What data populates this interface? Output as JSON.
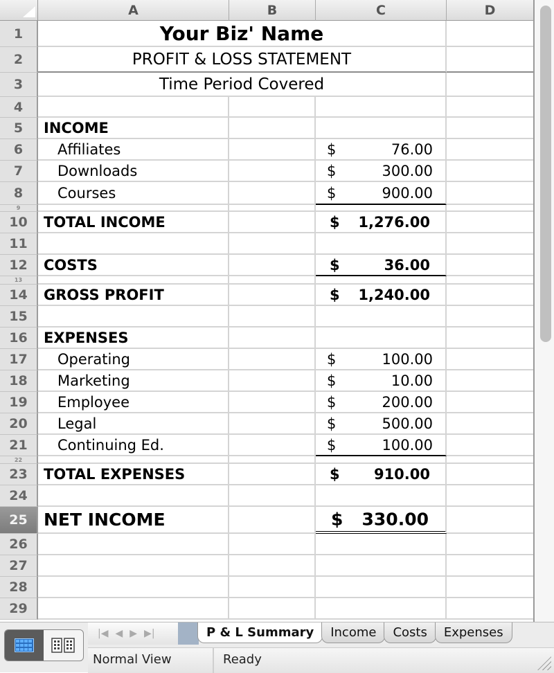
{
  "columns": [
    "A",
    "B",
    "C",
    "D"
  ],
  "header": {
    "biz_name": "Your Biz' Name",
    "statement": "PROFIT & LOSS STATEMENT",
    "period": "Time Period Covered"
  },
  "rows": {
    "r1": "1",
    "r2": "2",
    "r3": "3",
    "r4": "4",
    "r5": "5",
    "r6": "6",
    "r7": "7",
    "r8": "8",
    "r9": "9",
    "r10": "10",
    "r11": "11",
    "r12": "12",
    "r13": "13",
    "r14": "14",
    "r15": "15",
    "r16": "16",
    "r17": "17",
    "r18": "18",
    "r19": "19",
    "r20": "20",
    "r21": "21",
    "r22": "22",
    "r23": "23",
    "r24": "24",
    "r25": "25",
    "r26": "26",
    "r27": "27",
    "r28": "28",
    "r29": "29"
  },
  "currency_symbol": "$",
  "income": {
    "heading": "INCOME",
    "items": [
      {
        "label": "Affiliates",
        "amount": "76.00"
      },
      {
        "label": "Downloads",
        "amount": "300.00"
      },
      {
        "label": "Courses",
        "amount": "900.00"
      }
    ],
    "total_label": "TOTAL INCOME",
    "total": "1,276.00"
  },
  "costs": {
    "label": "COSTS",
    "amount": "36.00"
  },
  "gross_profit": {
    "label": "GROSS PROFIT",
    "amount": "1,240.00"
  },
  "expenses": {
    "heading": "EXPENSES",
    "items": [
      {
        "label": "Operating",
        "amount": "100.00"
      },
      {
        "label": "Marketing",
        "amount": "10.00"
      },
      {
        "label": "Employee",
        "amount": "200.00"
      },
      {
        "label": "Legal",
        "amount": "500.00"
      },
      {
        "label": "Continuing Ed.",
        "amount": "100.00"
      }
    ],
    "total_label": "TOTAL EXPENSES",
    "total": "910.00"
  },
  "net_income": {
    "label": "NET INCOME",
    "amount": "330.00"
  },
  "selected_row": "25",
  "sheet_tabs": [
    {
      "label": "P & L Summary",
      "active": true
    },
    {
      "label": "Income",
      "active": false
    },
    {
      "label": "Costs",
      "active": false
    },
    {
      "label": "Expenses",
      "active": false
    }
  ],
  "nav_icons": [
    "first-sheet-icon",
    "prev-sheet-icon",
    "next-sheet-icon",
    "last-sheet-icon"
  ],
  "view_buttons": [
    {
      "name": "normal-view-icon",
      "active": true
    },
    {
      "name": "page-layout-view-icon",
      "active": false
    }
  ],
  "status_bar": {
    "view": "Normal View",
    "state": "Ready"
  },
  "colors": {
    "accent_blue": "#3d8fe0",
    "selected_row_header": "#8a8a8a",
    "grid": "#d4d4d4"
  }
}
